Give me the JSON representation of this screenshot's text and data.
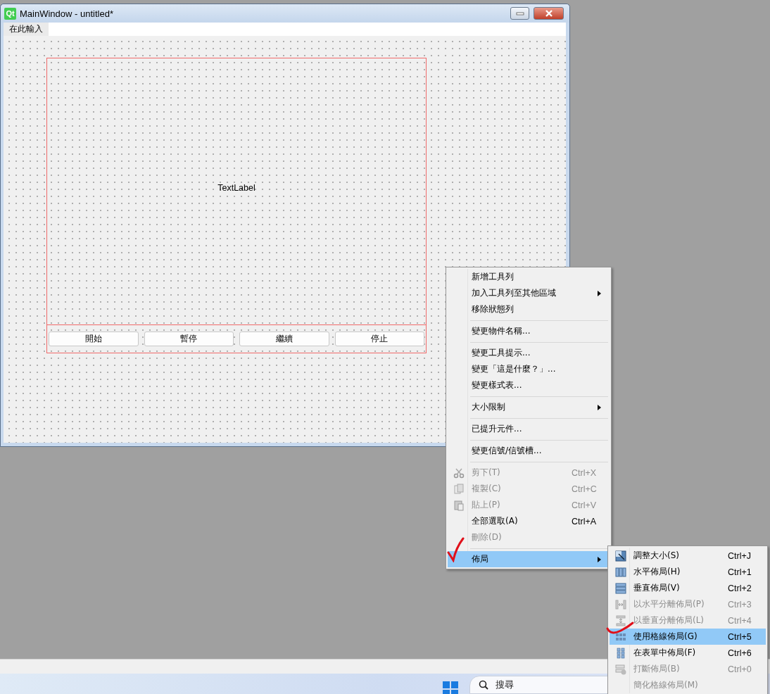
{
  "window": {
    "logo_text": "Qt",
    "title": "MainWindow - untitled*",
    "menu_items": [
      {
        "label": "在此輸入"
      }
    ]
  },
  "form": {
    "label_text": "TextLabel",
    "buttons": [
      "開始",
      "暫停",
      "繼續",
      "停止"
    ]
  },
  "context_menu": {
    "items": [
      {
        "kind": "item",
        "label": "新增工具列",
        "disabled": false,
        "submenu": false,
        "selected": false
      },
      {
        "kind": "item",
        "label": "加入工具列至其他區域",
        "disabled": false,
        "submenu": true,
        "selected": false
      },
      {
        "kind": "item",
        "label": "移除狀態列",
        "disabled": false,
        "submenu": false,
        "selected": false
      },
      {
        "kind": "separator"
      },
      {
        "kind": "item",
        "label": "變更物件名稱...",
        "disabled": false,
        "submenu": false,
        "selected": false
      },
      {
        "kind": "separator"
      },
      {
        "kind": "item",
        "label": "變更工具提示...",
        "disabled": false,
        "submenu": false,
        "selected": false
      },
      {
        "kind": "item",
        "label": "變更「這是什麼？」...",
        "disabled": false,
        "submenu": false,
        "selected": false
      },
      {
        "kind": "item",
        "label": "變更樣式表...",
        "disabled": false,
        "submenu": false,
        "selected": false
      },
      {
        "kind": "separator"
      },
      {
        "kind": "item",
        "label": "大小限制",
        "disabled": false,
        "submenu": true,
        "selected": false
      },
      {
        "kind": "separator"
      },
      {
        "kind": "item",
        "label": "已提升元件...",
        "disabled": false,
        "submenu": false,
        "selected": false
      },
      {
        "kind": "separator"
      },
      {
        "kind": "item",
        "label": "變更信號/信號槽...",
        "disabled": false,
        "submenu": false,
        "selected": false
      },
      {
        "kind": "separator"
      },
      {
        "kind": "item",
        "label": "剪下(T)",
        "shortcut": "Ctrl+X",
        "disabled": true,
        "submenu": false,
        "selected": false
      },
      {
        "kind": "item",
        "label": "複製(C)",
        "shortcut": "Ctrl+C",
        "disabled": true,
        "submenu": false,
        "selected": false
      },
      {
        "kind": "item",
        "label": "貼上(P)",
        "shortcut": "Ctrl+V",
        "disabled": true,
        "submenu": false,
        "selected": false
      },
      {
        "kind": "item",
        "label": "全部選取(A)",
        "shortcut": "Ctrl+A",
        "disabled": false,
        "submenu": false,
        "selected": false
      },
      {
        "kind": "item",
        "label": "刪除(D)",
        "disabled": true,
        "submenu": false,
        "selected": false
      },
      {
        "kind": "separator"
      },
      {
        "kind": "item",
        "label": "佈局",
        "disabled": false,
        "submenu": true,
        "selected": true
      }
    ]
  },
  "layout_submenu": {
    "items": [
      {
        "label": "調整大小(S)",
        "shortcut": "Ctrl+J",
        "disabled": false,
        "selected": false
      },
      {
        "label": "水平佈局(H)",
        "shortcut": "Ctrl+1",
        "disabled": false,
        "selected": false
      },
      {
        "label": "垂直佈局(V)",
        "shortcut": "Ctrl+2",
        "disabled": false,
        "selected": false
      },
      {
        "label": "以水平分離佈局(P)",
        "shortcut": "Ctrl+3",
        "disabled": true,
        "selected": false
      },
      {
        "label": "以垂直分離佈局(L)",
        "shortcut": "Ctrl+4",
        "disabled": true,
        "selected": false
      },
      {
        "label": "使用格線佈局(G)",
        "shortcut": "Ctrl+5",
        "disabled": false,
        "selected": true
      },
      {
        "label": "在表單中佈局(F)",
        "shortcut": "Ctrl+6",
        "disabled": false,
        "selected": false
      },
      {
        "label": "打斷佈局(B)",
        "shortcut": "Ctrl+0",
        "disabled": true,
        "selected": false
      },
      {
        "label": "簡化格線佈局(M)",
        "disabled": true,
        "selected": false
      }
    ]
  },
  "taskbar": {
    "search": {
      "placeholder": "搜尋"
    }
  }
}
